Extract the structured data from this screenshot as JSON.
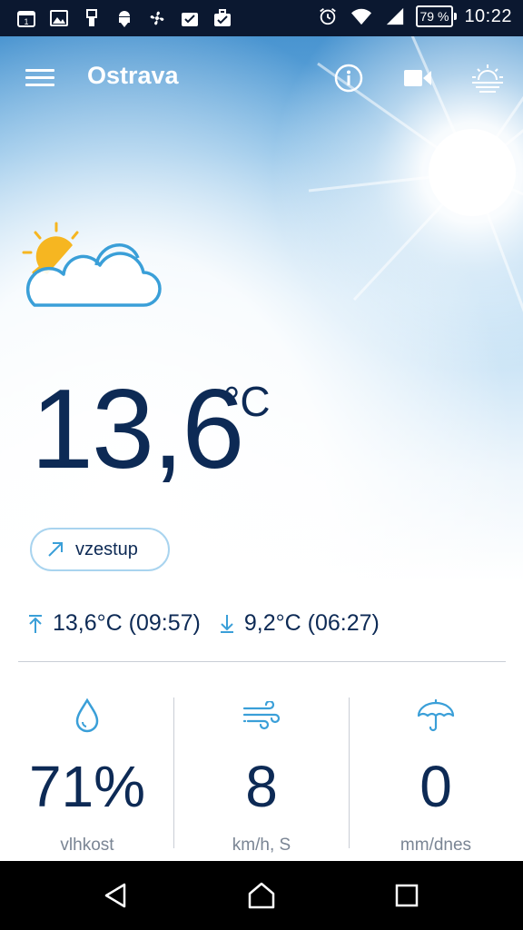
{
  "status_bar": {
    "battery_percent": "79 %",
    "time": "10:22",
    "icons": [
      "calendar-icon",
      "gallery-icon",
      "usb-icon",
      "android-debug-icon",
      "fan-icon",
      "task-check-icon",
      "briefcase-check-icon",
      "alarm-icon",
      "wifi-icon",
      "signal-icon",
      "battery-icon"
    ]
  },
  "app_bar": {
    "title": "Ostrava",
    "actions": [
      "info-icon",
      "camera-icon",
      "sunrise-icon"
    ]
  },
  "current": {
    "condition_icon": "partly-cloudy-icon",
    "temperature": "13,6",
    "unit": "°C",
    "trend_label": "vzestup"
  },
  "extremes": {
    "max": "13,6°C (09:57)",
    "min": "9,2°C (06:27)"
  },
  "metrics": [
    {
      "icon": "humidity-drop-icon",
      "value": "71%",
      "label": "vlhkost"
    },
    {
      "icon": "wind-icon",
      "value": "8",
      "label": "km/h, S"
    },
    {
      "icon": "umbrella-icon",
      "value": "0",
      "label": "mm/dnes"
    }
  ],
  "colors": {
    "primary_text": "#0d2a55",
    "accent_blue": "#3a9fd8",
    "secondary_text": "#7a8594",
    "sun_yellow": "#f6b621",
    "status_bar": "#0b1830"
  }
}
